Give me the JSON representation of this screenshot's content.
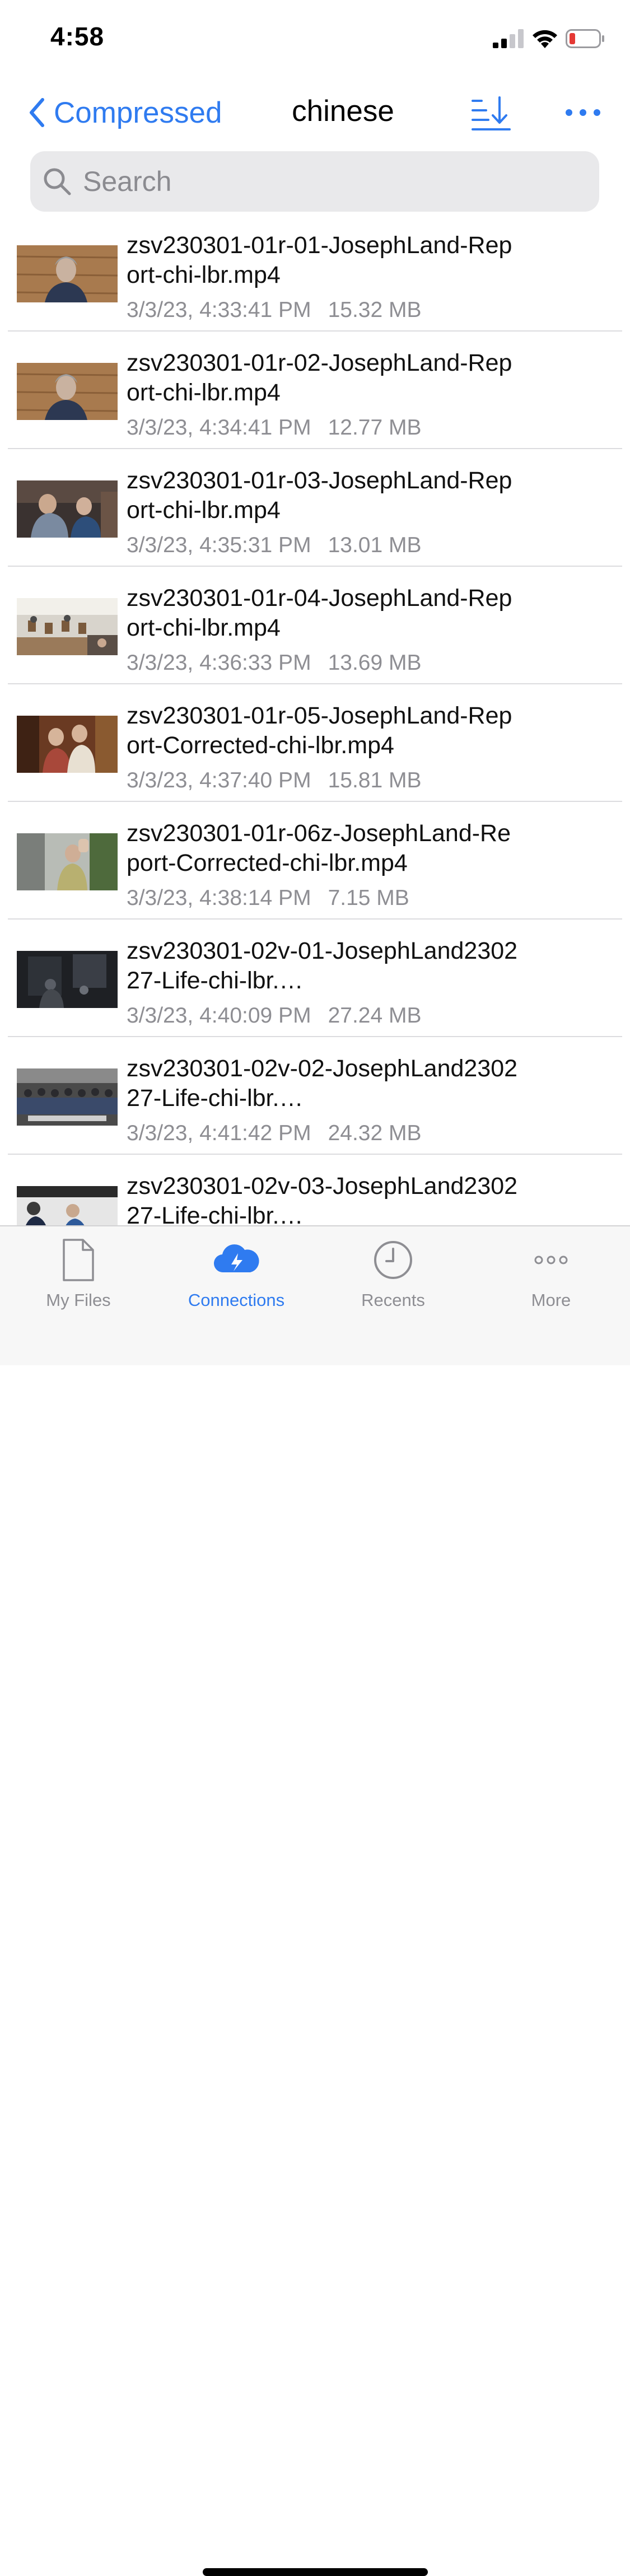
{
  "status": {
    "time": "4:58"
  },
  "nav": {
    "back_label": "Compressed",
    "title": "chinese"
  },
  "search": {
    "placeholder": "Search"
  },
  "files": [
    {
      "name": "zsv230301-01r-01-JosephLand-Report-chi-lbr.mp4",
      "date": "3/3/23, 4:33:41 PM",
      "size": "15.32 MB"
    },
    {
      "name": "zsv230301-01r-02-JosephLand-Report-chi-lbr.mp4",
      "date": "3/3/23, 4:34:41 PM",
      "size": "12.77 MB"
    },
    {
      "name": "zsv230301-01r-03-JosephLand-Report-chi-lbr.mp4",
      "date": "3/3/23, 4:35:31 PM",
      "size": "13.01 MB"
    },
    {
      "name": "zsv230301-01r-04-JosephLand-Report-chi-lbr.mp4",
      "date": "3/3/23, 4:36:33 PM",
      "size": "13.69 MB"
    },
    {
      "name": "zsv230301-01r-05-JosephLand-Report-Corrected-chi-lbr.mp4",
      "date": "3/3/23, 4:37:40 PM",
      "size": "15.81 MB"
    },
    {
      "name": "zsv230301-01r-06z-JosephLand-Report-Corrected-chi-lbr.mp4",
      "date": "3/3/23, 4:38:14 PM",
      "size": "7.15 MB"
    },
    {
      "name": "zsv230301-02v-01-JosephLand230227-Life-chi-lbr.…",
      "date": "3/3/23, 4:40:09 PM",
      "size": "27.24 MB"
    },
    {
      "name": "zsv230301-02v-02-JosephLand230227-Life-chi-lbr.…",
      "date": "3/3/23, 4:41:42 PM",
      "size": "24.32 MB"
    },
    {
      "name": "zsv230301-02v-03-JosephLand230227-Life-chi-lbr.…",
      "date": "",
      "size": ""
    }
  ],
  "tabs": [
    {
      "label": "My Files",
      "icon": "document-icon"
    },
    {
      "label": "Connections",
      "icon": "cloud-bolt-icon",
      "active": true
    },
    {
      "label": "Recents",
      "icon": "clock-icon"
    },
    {
      "label": "More",
      "icon": "ellipsis-icon"
    }
  ],
  "colors": {
    "accent": "#2f7bf0",
    "secondary_text": "#8e8e93",
    "search_bg": "#e9e9eb",
    "battery_low": "#e53935"
  }
}
